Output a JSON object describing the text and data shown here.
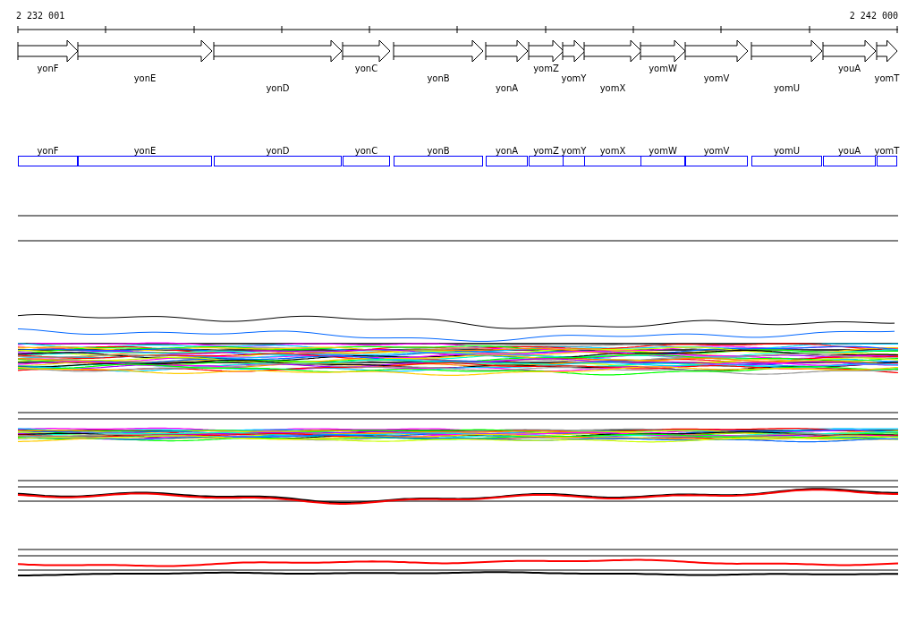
{
  "ruler": {
    "start_label": "2 232 001",
    "end_label": "2 242 000"
  },
  "gene_track": {
    "genes": [
      "yonF",
      "yonE",
      "yonD",
      "yonC",
      "yonB",
      "yonA",
      "yomZ",
      "yomY",
      "yomX",
      "yomW",
      "yomV",
      "yomU",
      "youA",
      "yomT"
    ]
  },
  "box_track": {
    "genes": [
      "yonF",
      "yonE",
      "yonD",
      "yonC",
      "yonB",
      "yonA",
      "yomZ",
      "yomY",
      "yomX",
      "yomW",
      "yomV",
      "yomU",
      "youA",
      "yomT"
    ]
  }
}
